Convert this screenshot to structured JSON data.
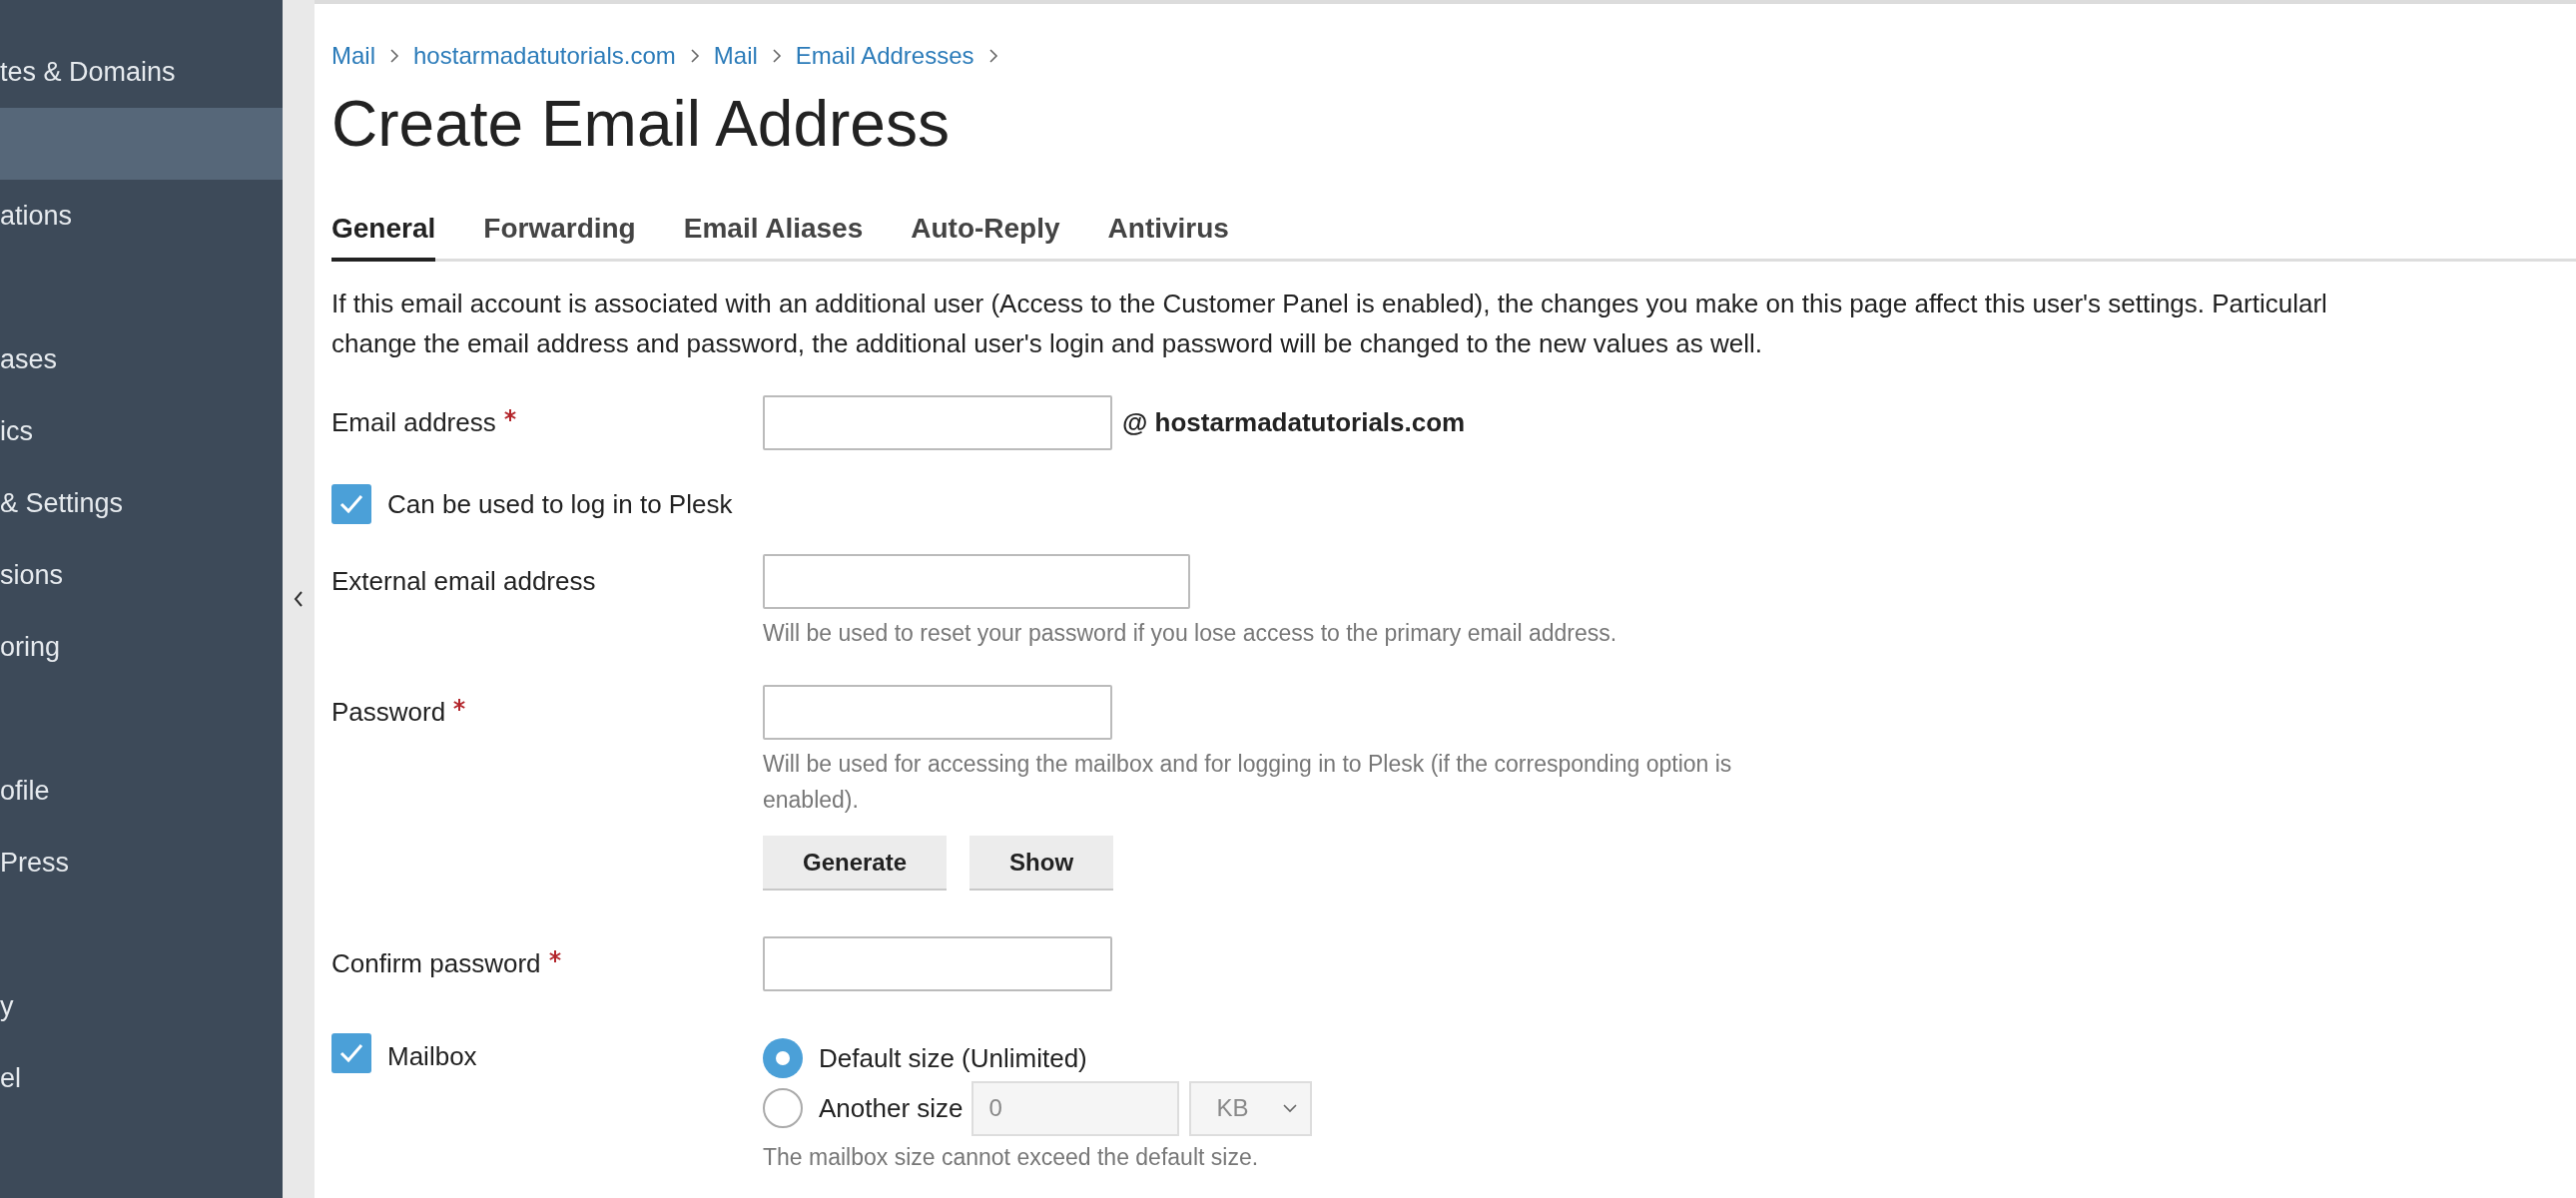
{
  "sidebar": {
    "items": [
      {
        "label": "tes & Domains",
        "selected": false
      },
      {
        "selected": true
      },
      {
        "label": "ations",
        "selected": false
      },
      {
        "selected": false
      },
      {
        "label": "ases",
        "selected": false
      },
      {
        "label": "ics",
        "selected": false
      },
      {
        "label": "& Settings",
        "selected": false
      },
      {
        "label": "sions",
        "selected": false
      },
      {
        "label": "oring",
        "selected": false
      },
      {
        "selected": false
      },
      {
        "label": "ofile",
        "selected": false
      },
      {
        "label": "Press",
        "selected": false
      },
      {
        "selected": false
      },
      {
        "label": "y",
        "selected": false
      },
      {
        "label": "el",
        "selected": false
      }
    ]
  },
  "breadcrumbs": [
    "Mail",
    "hostarmadatutorials.com",
    "Mail",
    "Email Addresses"
  ],
  "title": "Create Email Address",
  "tabs": [
    {
      "label": "General",
      "selected": true
    },
    {
      "label": "Forwarding",
      "selected": false
    },
    {
      "label": "Email Aliases",
      "selected": false
    },
    {
      "label": "Auto-Reply",
      "selected": false
    },
    {
      "label": "Antivirus",
      "selected": false
    }
  ],
  "intro_lines": [
    "If this email account is associated with an additional user (Access to the Customer Panel is enabled), the changes you make on this page affect this user's settings. Particularl",
    "change the email address and password, the additional user's login and password will be changed to the new values as well."
  ],
  "form": [
    {
      "kind": "input",
      "label": "Email address",
      "required": true,
      "suffix": "@ hostarmadatutorials.com"
    },
    {
      "kind": "checkbox",
      "label": "Can be used to log in to Plesk",
      "checked": true
    },
    {
      "kind": "input",
      "label": "External email address",
      "required": false,
      "hint": "Will be used to reset your password if you lose access to the primary email address."
    },
    {
      "kind": "input",
      "label": "Password",
      "required": true,
      "hint": "Will be used for accessing the mailbox and for logging in to Plesk (if the corresponding option is enabled).",
      "buttons": [
        "Generate",
        "Show"
      ]
    },
    {
      "kind": "input",
      "label": "Confirm password",
      "required": true
    },
    {
      "kind": "mailbox",
      "label": "Mailbox",
      "checked": true,
      "options": [
        {
          "label": "Default size (Unlimited)",
          "selected": true
        },
        {
          "label": "Another size",
          "selected": false,
          "value": "0",
          "unit": "KB"
        }
      ],
      "hint": "The mailbox size cannot exceed the default size."
    }
  ]
}
